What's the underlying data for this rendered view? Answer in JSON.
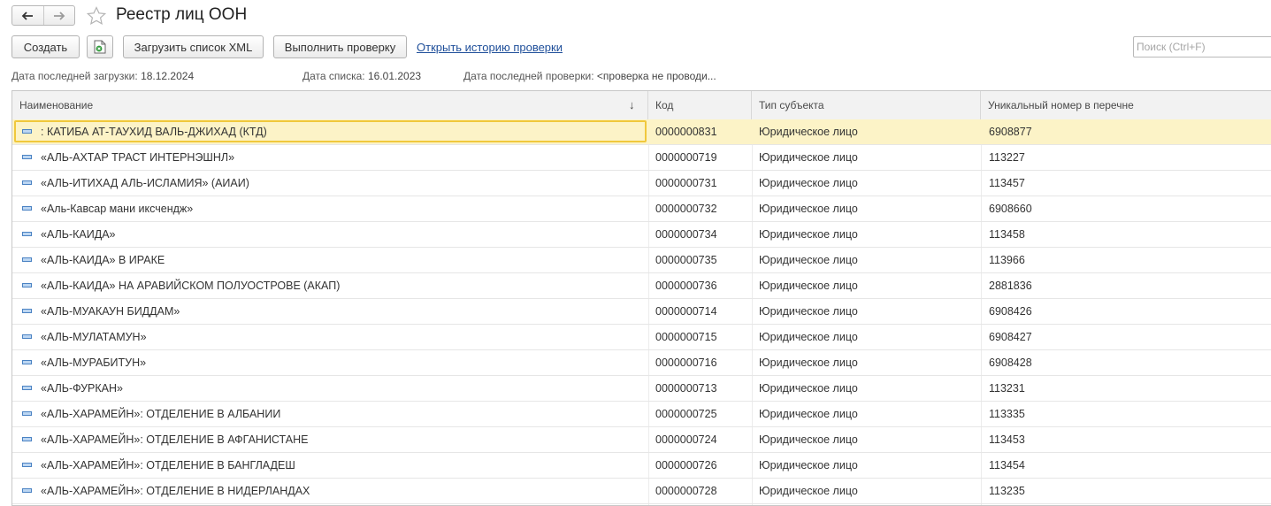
{
  "window": {
    "title": "Реестр лиц ООН"
  },
  "toolbar": {
    "create_label": "Создать",
    "load_xml_label": "Загрузить список XML",
    "run_check_label": "Выполнить проверку",
    "history_link_label": "Открыть историю проверки",
    "search_placeholder": "Поиск (Ctrl+F)"
  },
  "info": {
    "last_load_label": "Дата последней загрузки:",
    "last_load_value": "18.12.2024",
    "list_date_label": "Дата списка:",
    "list_date_value": "16.01.2023",
    "last_check_label": "Дата последней проверки:",
    "last_check_value": "<проверка не проводи..."
  },
  "table": {
    "columns": [
      "Наименование",
      "Код",
      "Тип субъекта",
      "Уникальный номер в перечне"
    ],
    "sort_indicator": "↓",
    "rows": [
      {
        "name": ": КАТИБА АТ-ТАУХИД ВАЛЬ-ДЖИХАД (КТД)",
        "code": "0000000831",
        "type": "Юридическое лицо",
        "number": "6908877"
      },
      {
        "name": "«АЛЬ-АХТАР ТРАСТ ИНТЕРНЭШНЛ»",
        "code": "0000000719",
        "type": "Юридическое лицо",
        "number": "113227"
      },
      {
        "name": "«АЛЬ-ИТИХАД АЛЬ-ИСЛАМИЯ» (АИАИ)",
        "code": "0000000731",
        "type": "Юридическое лицо",
        "number": "113457"
      },
      {
        "name": "«Аль-Кавсар мани иксчендж»",
        "code": "0000000732",
        "type": "Юридическое лицо",
        "number": "6908660"
      },
      {
        "name": "«АЛЬ-КАИДА»",
        "code": "0000000734",
        "type": "Юридическое лицо",
        "number": "113458"
      },
      {
        "name": "«АЛЬ-КАИДА» В ИРАКЕ",
        "code": "0000000735",
        "type": "Юридическое лицо",
        "number": "113966"
      },
      {
        "name": "«АЛЬ-КАИДА» НА АРАВИЙСКОМ ПОЛУОСТРОВЕ (АКАП)",
        "code": "0000000736",
        "type": "Юридическое лицо",
        "number": "2881836"
      },
      {
        "name": "«АЛЬ-МУАКАУН БИДДАМ»",
        "code": "0000000714",
        "type": "Юридическое лицо",
        "number": "6908426"
      },
      {
        "name": "«АЛЬ-МУЛАТАМУН»",
        "code": "0000000715",
        "type": "Юридическое лицо",
        "number": "6908427"
      },
      {
        "name": "«АЛЬ-МУРАБИТУН»",
        "code": "0000000716",
        "type": "Юридическое лицо",
        "number": "6908428"
      },
      {
        "name": "«АЛЬ-ФУРКАН»",
        "code": "0000000713",
        "type": "Юридическое лицо",
        "number": "113231"
      },
      {
        "name": "«АЛЬ-ХАРАМЕЙН»: ОТДЕЛЕНИЕ В АЛБАНИИ",
        "code": "0000000725",
        "type": "Юридическое лицо",
        "number": "113335"
      },
      {
        "name": "«АЛЬ-ХАРАМЕЙН»: ОТДЕЛЕНИЕ В АФГАНИСТАНЕ",
        "code": "0000000724",
        "type": "Юридическое лицо",
        "number": "113453"
      },
      {
        "name": "«АЛЬ-ХАРАМЕЙН»: ОТДЕЛЕНИЕ В БАНГЛАДЕШ",
        "code": "0000000726",
        "type": "Юридическое лицо",
        "number": "113454"
      },
      {
        "name": "«АЛЬ-ХАРАМЕЙН»: ОТДЕЛЕНИЕ В НИДЕРЛАНДАХ",
        "code": "0000000728",
        "type": "Юридическое лицо",
        "number": "113235"
      }
    ]
  },
  "icons": {
    "back": "arrow-left-icon",
    "forward": "arrow-right-icon",
    "favorite": "star-icon",
    "excel": "excel-icon",
    "row": "catalog-item-icon"
  },
  "colors": {
    "selected_row": "#fcf3c7",
    "focus_border": "#f0c83c",
    "link": "#1f4f9a"
  }
}
